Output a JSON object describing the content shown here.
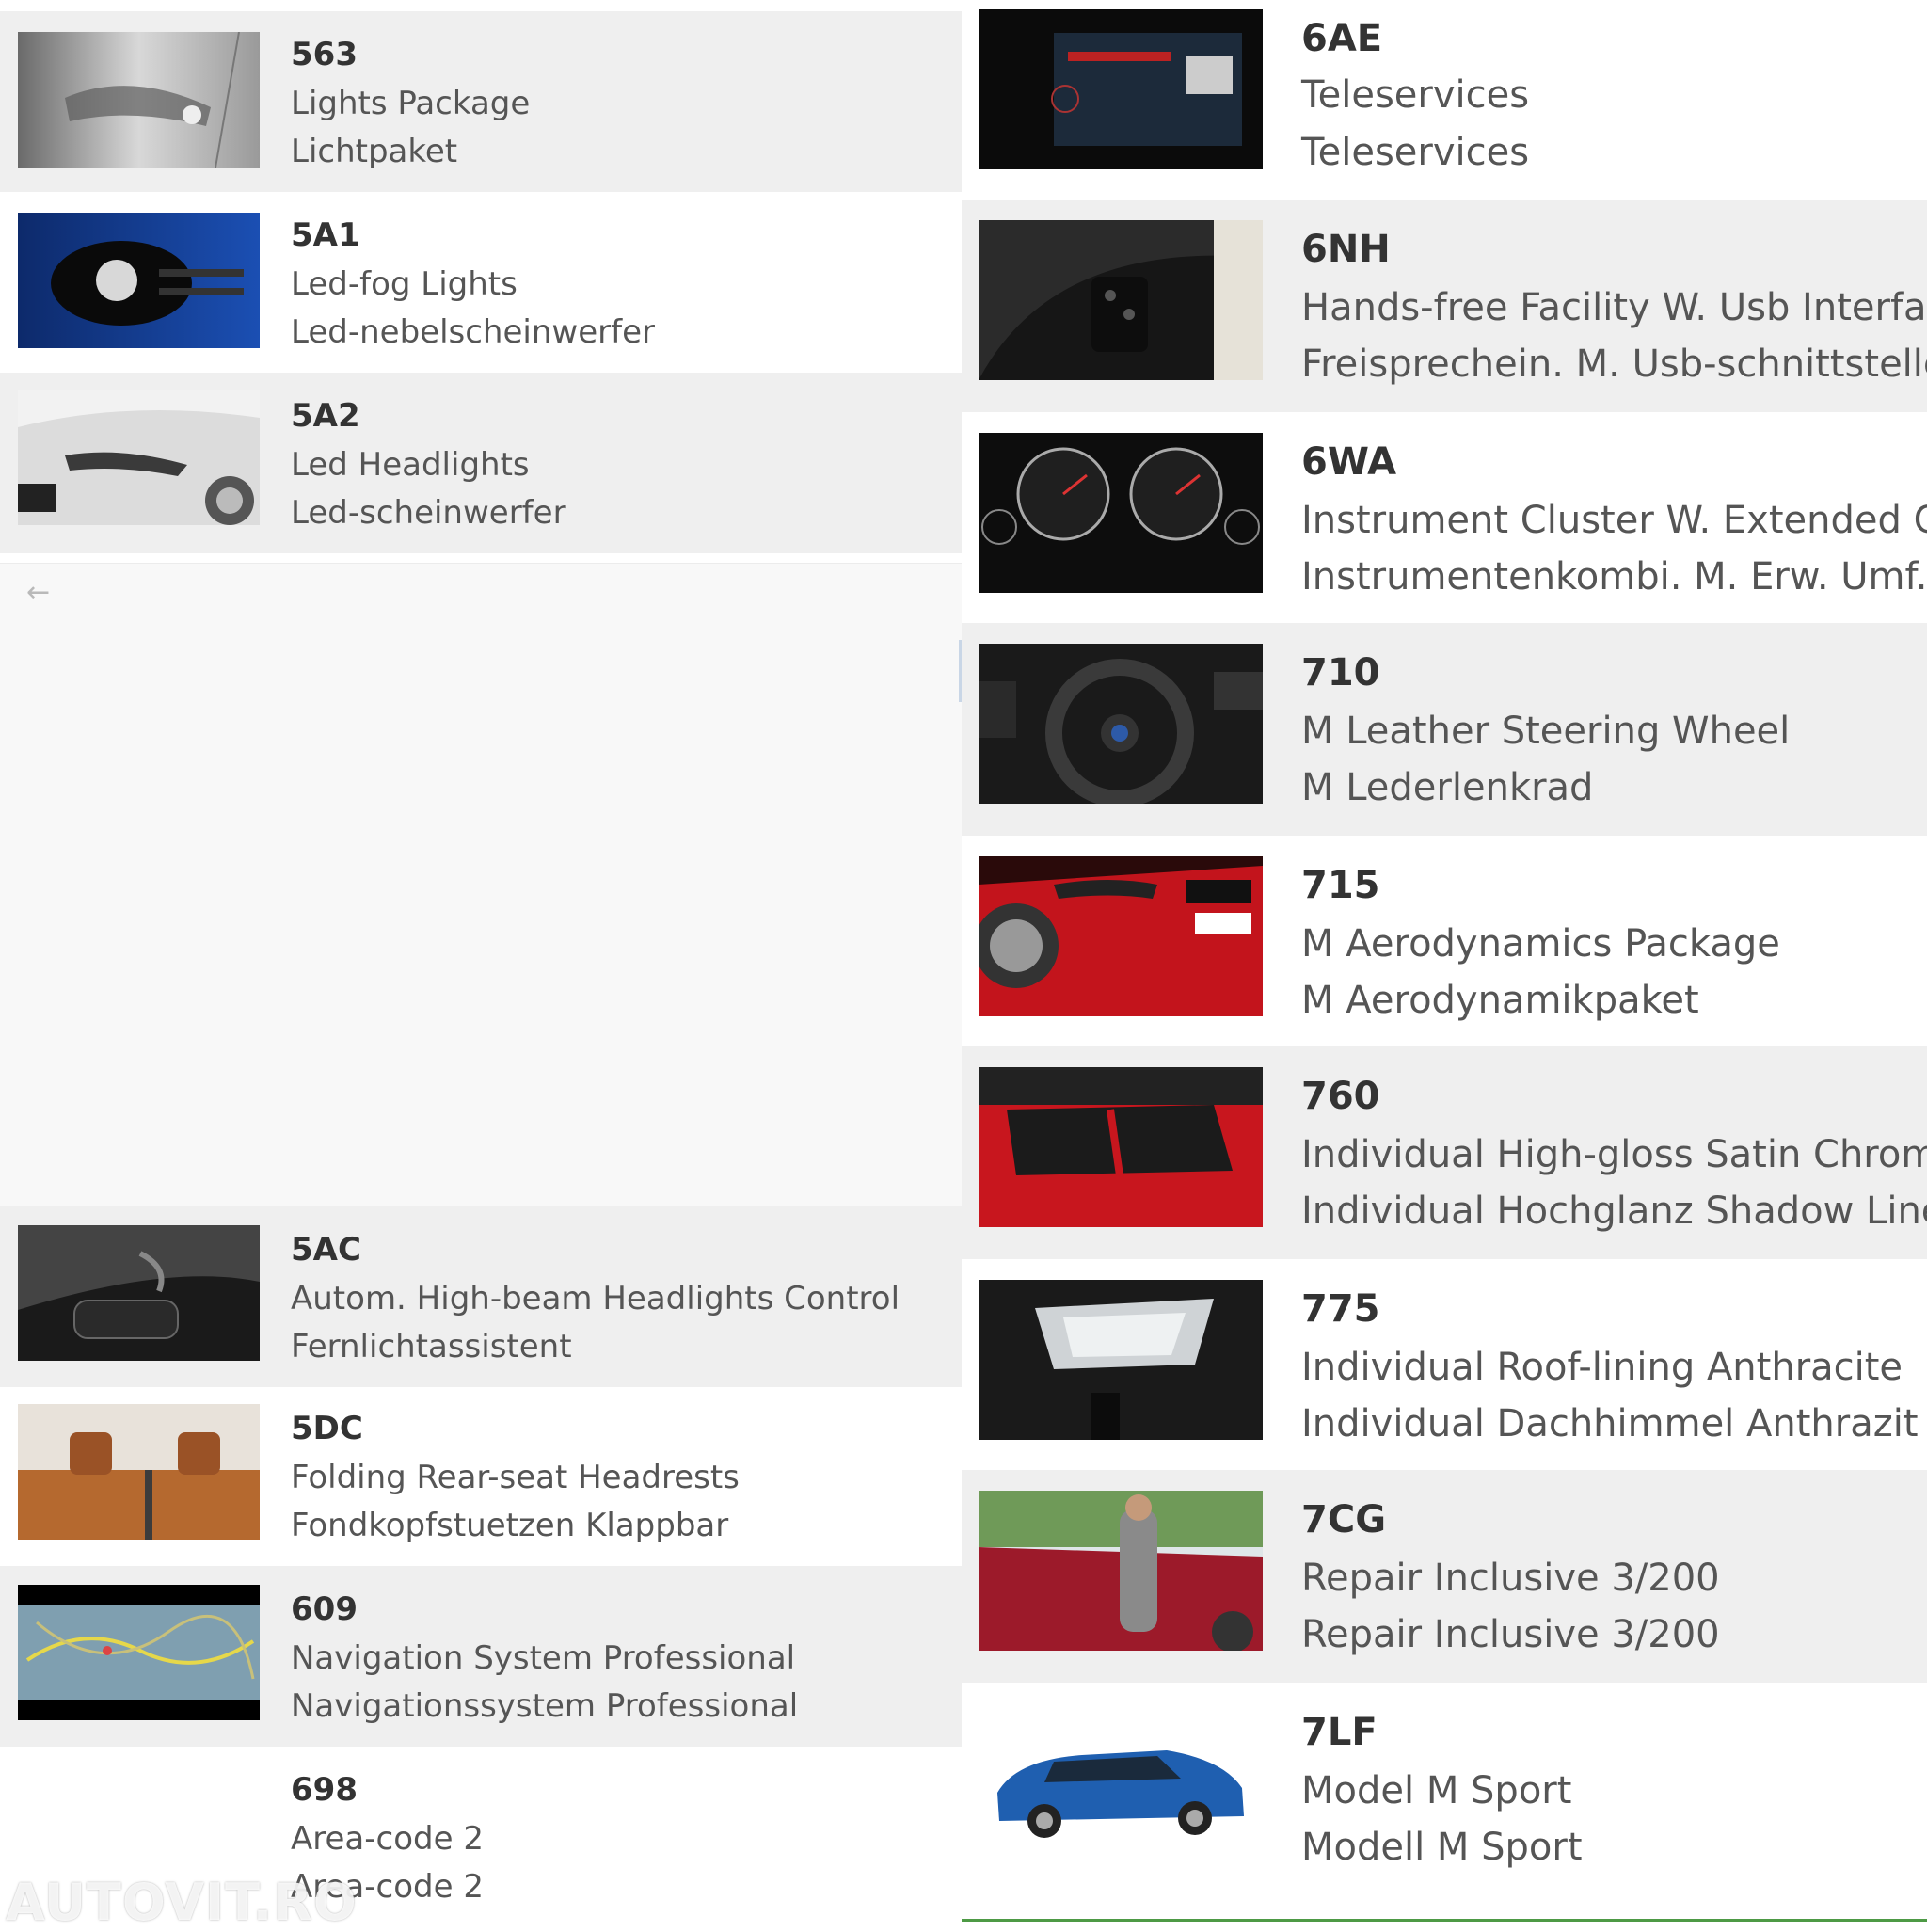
{
  "left_options": [
    {
      "code": "563",
      "en": "Lights Package",
      "de": "Lichtpaket"
    },
    {
      "code": "5A1",
      "en": "Led-fog Lights",
      "de": "Led-nebelscheinwerfer"
    },
    {
      "code": "5A2",
      "en": "Led Headlights",
      "de": "Led-scheinwerfer"
    },
    {
      "code": "5AC",
      "en": "Autom. High-beam Headlights Control",
      "de": "Fernlichtassistent"
    },
    {
      "code": "5DC",
      "en": "Folding Rear-seat Headrests",
      "de": "Fondkopfstuetzen Klappbar"
    },
    {
      "code": "609",
      "en": "Navigation System Professional",
      "de": "Navigationssystem Professional"
    },
    {
      "code": "698",
      "en": "Area-code 2",
      "de": "Area-code 2"
    }
  ],
  "right_options": [
    {
      "code": "6AE",
      "en": "Teleservices",
      "de": "Teleservices"
    },
    {
      "code": "6NH",
      "en": "Hands-free Facility W. Usb Interfac",
      "de": "Freisprechein. M. Usb-schnittstelle"
    },
    {
      "code": "6WA",
      "en": "Instrument Cluster W. Extended Cont",
      "de": "Instrumentenkombi. M. Erw. Umf."
    },
    {
      "code": "710",
      "en": "M Leather Steering Wheel",
      "de": "M Lederlenkrad"
    },
    {
      "code": "715",
      "en": "M Aerodynamics Package",
      "de": "M Aerodynamikpaket"
    },
    {
      "code": "760",
      "en": "Individual High-gloss Satin Chrome",
      "de": "Individual Hochglanz Shadow Line"
    },
    {
      "code": "775",
      "en": "Individual Roof-lining Anthracite",
      "de": "Individual Dachhimmel Anthrazit"
    },
    {
      "code": "7CG",
      "en": "Repair Inclusive 3/200",
      "de": "Repair Inclusive 3/200"
    },
    {
      "code": "7LF",
      "en": "Model M Sport",
      "de": "Modell M Sport"
    }
  ],
  "nav": {
    "back_icon": "←"
  },
  "watermark": "AUTOVIT.RO",
  "colors": {
    "row_grey": "#efefef",
    "row_white": "#ffffff",
    "accent_line": "#4d9a45"
  }
}
